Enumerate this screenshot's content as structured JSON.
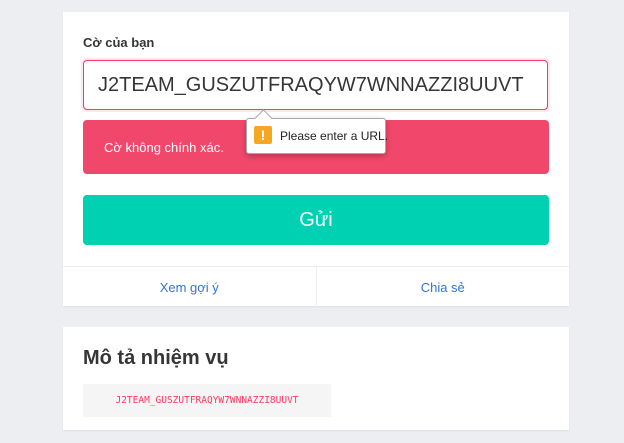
{
  "flag_card": {
    "label": "Cờ của bạn",
    "input_value": "J2TEAM_GUSZUTFRAQYW7WNNAZZI8UUVT",
    "error_message": "Cờ không chính xác.",
    "submit_label": "Gửi",
    "footer_links": [
      {
        "label": "Xem gợi ý"
      },
      {
        "label": "Chia sẻ"
      }
    ]
  },
  "validation_tooltip": {
    "icon": "warning-icon",
    "icon_glyph": "!",
    "text": "Please enter a URL."
  },
  "description_card": {
    "title": "Mô tả nhiệm vụ",
    "code": "J2TEAM_GUSZUTFRAQYW7WNNAZZI8UUVT"
  },
  "colors": {
    "page_bg": "#eceef2",
    "danger": "#f1476a",
    "input_border": "#ff3860",
    "primary": "#00d1b2",
    "link": "#3273dc",
    "code_text": "#ff3860",
    "warning": "#f5a623"
  }
}
